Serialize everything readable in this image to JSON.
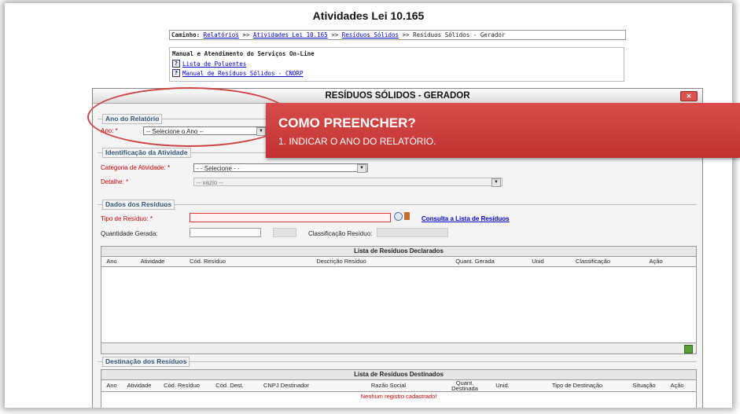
{
  "page": {
    "title": "Atividades Lei 10.165"
  },
  "breadcrumb": {
    "label": "Caminho:",
    "items": [
      "Relatórios",
      "Atividades Lei 10.165",
      "Resíduos Sólidos"
    ],
    "sep": ">>",
    "current": "Resíduos Sólidos - Gerador"
  },
  "manual": {
    "title": "Manual e Atendimento do Serviços On-Line",
    "links": [
      "Lista de Poluentes",
      "Manual de Resíduos Sólidos - CNORP"
    ]
  },
  "dialog": {
    "title": "RESÍDUOS SÓLIDOS - GERADOR",
    "close_label": "✕",
    "ano": {
      "legend": "Ano do Relatório",
      "label": "Ano: *",
      "value": "-- Selecione o Ano --"
    },
    "atividade": {
      "legend": "Identificação da Atividade",
      "categoria_label": "Categoria de Atividade: *",
      "categoria_value": "- - Selecione - -",
      "detalhe_label": "Detalhe: *",
      "detalhe_value": "-- vazio --"
    },
    "residuos": {
      "legend": "Dados dos Resíduos",
      "tipo_label": "Tipo de Resíduo: *",
      "consulta_link": "Consulta a Lista de Resíduos",
      "quantidade_label": "Quantidade Gerada:",
      "classificacao_label": "Classificação Resíduo:"
    },
    "declarados": {
      "title": "Lista de Resíduos Declarados",
      "columns": [
        "Ano",
        "Atividade",
        "Cód. Resíduo",
        "Descrição Resíduo",
        "Quant. Gerada",
        "Unid",
        "Classificação",
        "Ação"
      ]
    },
    "destinacao": {
      "legend": "Destinação dos Resíduos",
      "title": "Lista de Resíduos Destinados",
      "columns": [
        "Ano",
        "Atividade",
        "Cód. Resíduo",
        "Cód. Dest.",
        "CNPJ Destinador",
        "Razão Social",
        "Quant. Destinada",
        "Unid.",
        "Tipo de Destinação",
        "Situação",
        "Ação"
      ],
      "empty": "Nenhum registro cadastrado!"
    }
  },
  "callout": {
    "title": "COMO PREENCHER?",
    "text": "1. INDICAR O ANO DO RELATÓRIO."
  },
  "colors": {
    "callout": "#c93b3b",
    "required": "#cc0000",
    "link": "#0000cc",
    "legend": "#335577"
  }
}
